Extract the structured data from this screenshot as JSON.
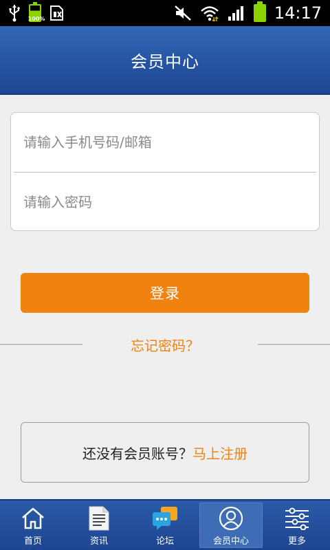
{
  "status_bar": {
    "battery_percent_label": "100%",
    "battery_level": 1.0,
    "time": "14:17"
  },
  "header": {
    "title": "会员中心"
  },
  "login_form": {
    "account_placeholder": "请输入手机号码/邮箱",
    "account_value": "",
    "password_placeholder": "请输入密码",
    "password_value": "",
    "login_label": "登录",
    "forgot_label": "忘记密码？"
  },
  "register": {
    "prompt": "还没有会员账号？",
    "link_label": "马上注册"
  },
  "bottom_nav": {
    "items": [
      {
        "label": "首页",
        "icon": "home-icon"
      },
      {
        "label": "资讯",
        "icon": "document-icon"
      },
      {
        "label": "论坛",
        "icon": "chat-bubble-icon"
      },
      {
        "label": "会员中心",
        "icon": "user-icon"
      },
      {
        "label": "更多",
        "icon": "sliders-icon"
      }
    ],
    "active_index": 3
  },
  "colors": {
    "accent_orange": "#f2820f",
    "header_blue": "#2452a0",
    "background": "#efefef"
  }
}
